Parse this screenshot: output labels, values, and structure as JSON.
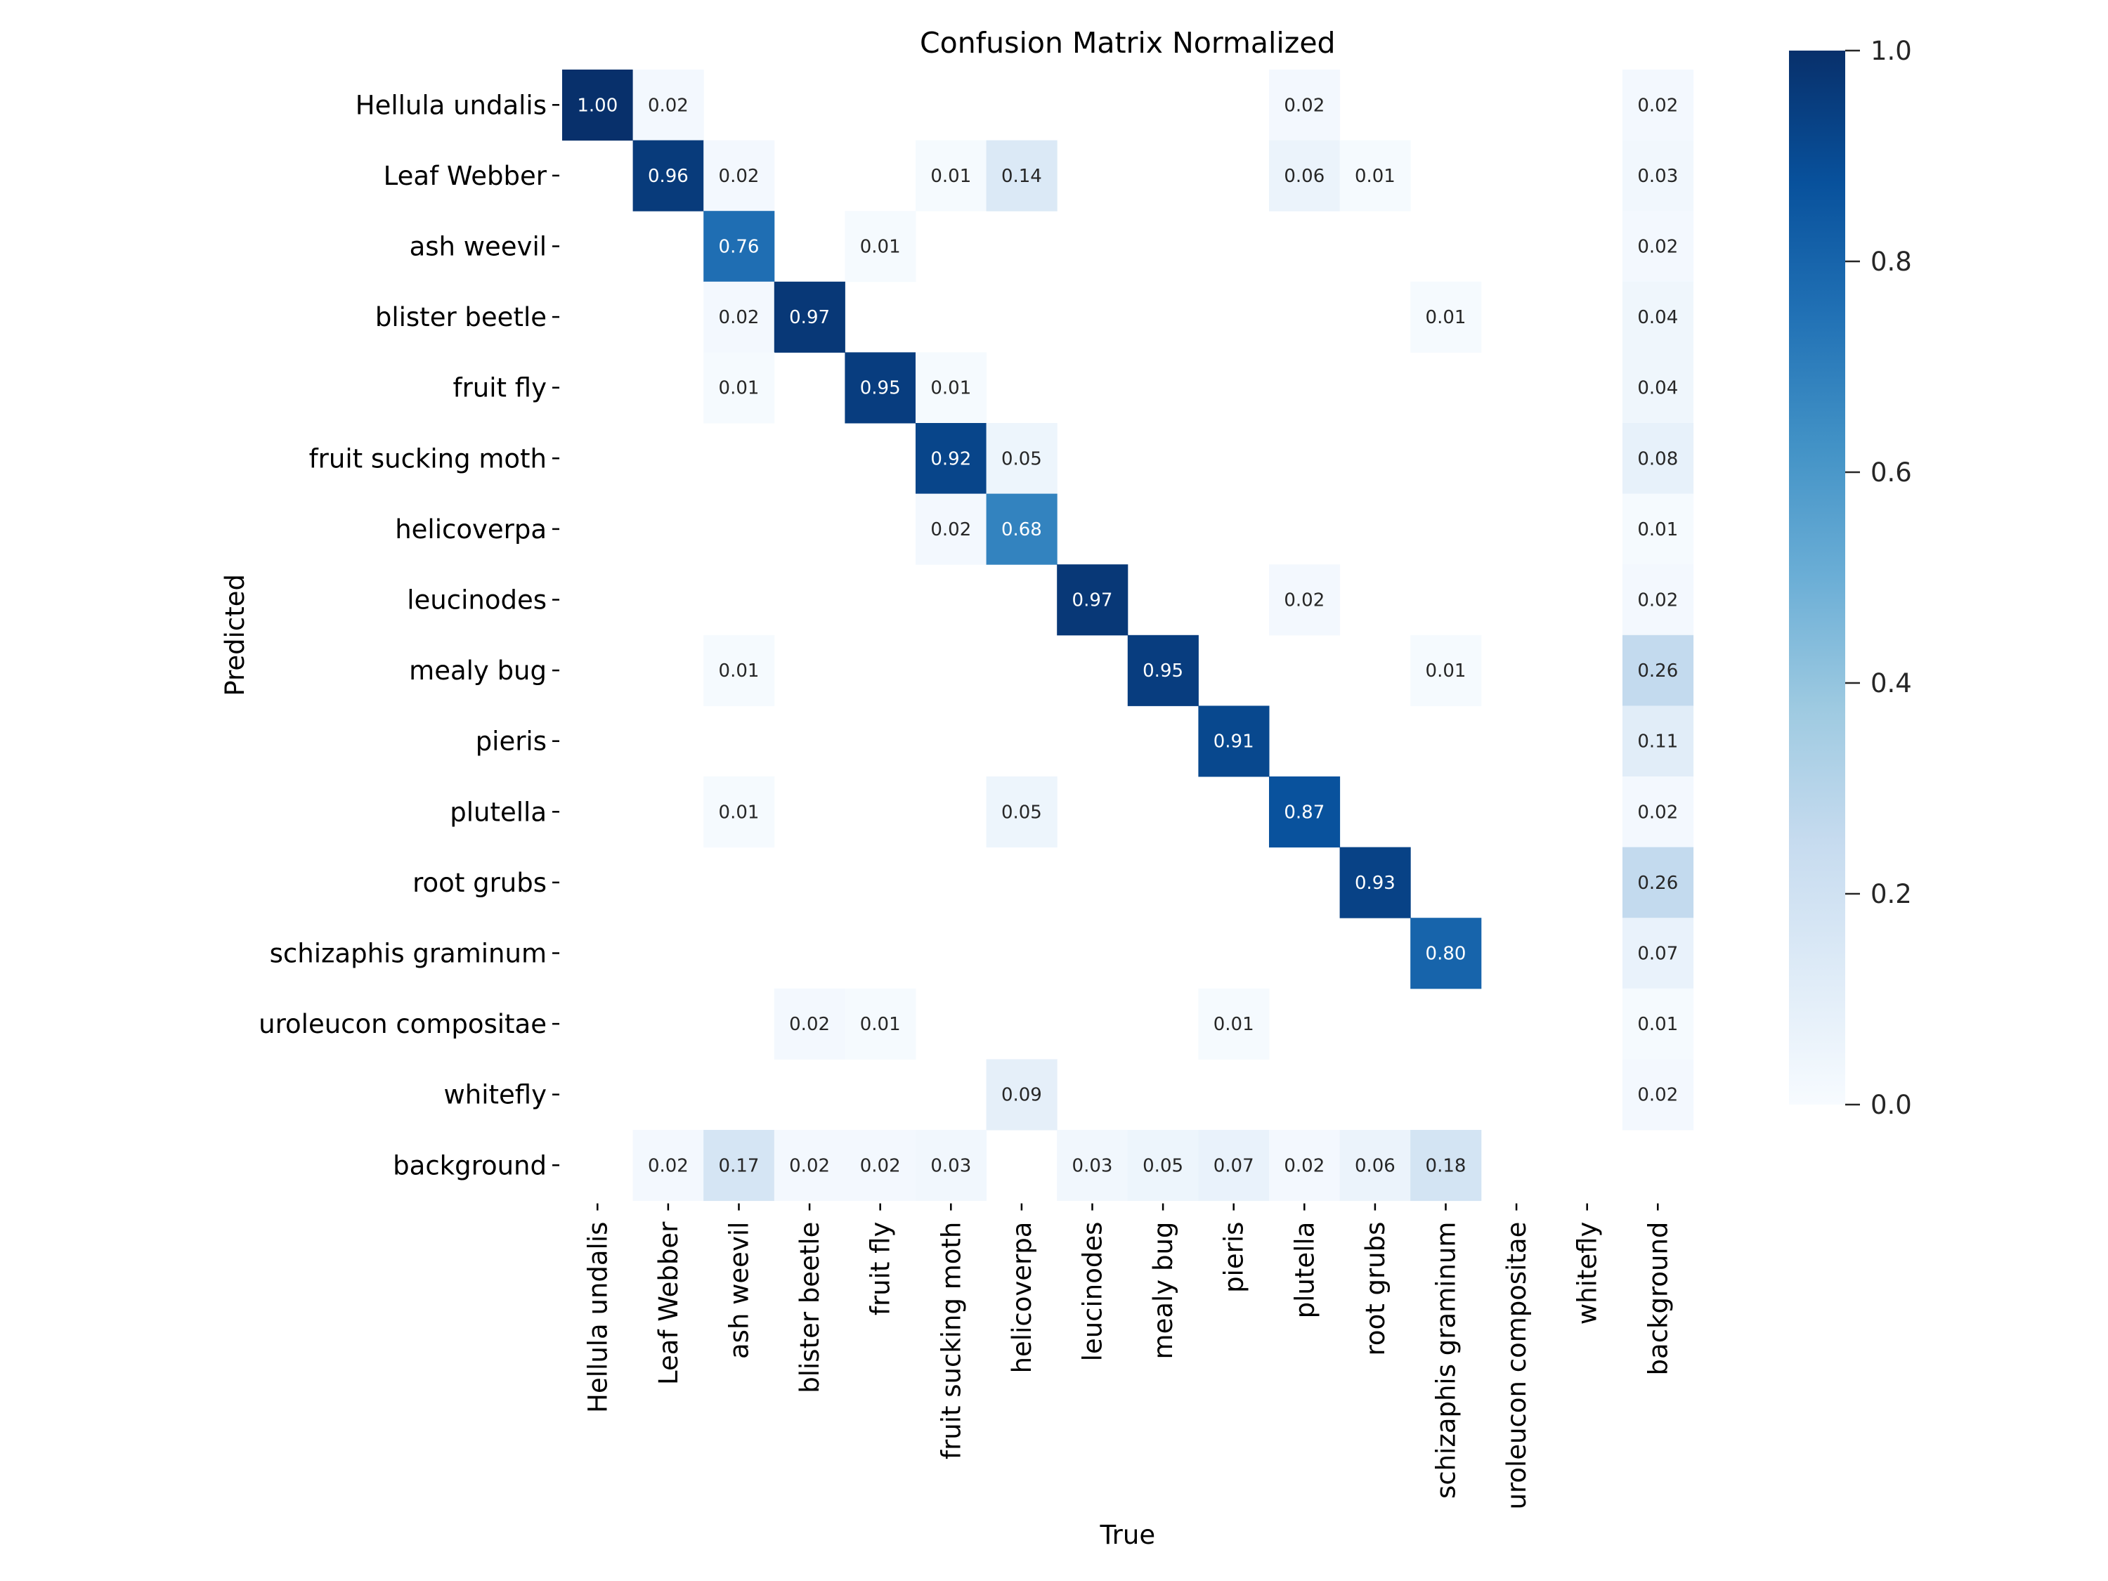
{
  "chart_data": {
    "type": "heatmap",
    "title": "Confusion Matrix Normalized",
    "xlabel": "True",
    "ylabel": "Predicted",
    "x_categories": [
      "Hellula undalis",
      "Leaf Webber",
      "ash weevil",
      "blister beetle",
      "fruit fly",
      "fruit sucking moth",
      "helicoverpa",
      "leucinodes",
      "mealy bug",
      "pieris",
      "plutella",
      "root grubs",
      "schizaphis graminum",
      "uroleucon compositae",
      "whitefly",
      "background"
    ],
    "y_categories": [
      "Hellula undalis",
      "Leaf Webber",
      "ash weevil",
      "blister beetle",
      "fruit fly",
      "fruit sucking moth",
      "helicoverpa",
      "leucinodes",
      "mealy bug",
      "pieris",
      "plutella",
      "root grubs",
      "schizaphis graminum",
      "uroleucon compositae",
      "whitefly",
      "background"
    ],
    "values": [
      [
        1.0,
        0.02,
        null,
        null,
        null,
        null,
        null,
        null,
        null,
        null,
        0.02,
        null,
        null,
        null,
        null,
        0.02
      ],
      [
        null,
        0.96,
        0.02,
        null,
        null,
        0.01,
        0.14,
        null,
        null,
        null,
        0.06,
        0.01,
        null,
        null,
        null,
        0.03
      ],
      [
        null,
        null,
        0.76,
        null,
        0.01,
        null,
        null,
        null,
        null,
        null,
        null,
        null,
        null,
        null,
        null,
        0.02
      ],
      [
        null,
        null,
        0.02,
        0.97,
        null,
        null,
        null,
        null,
        null,
        null,
        null,
        null,
        0.01,
        null,
        null,
        0.04
      ],
      [
        null,
        null,
        0.01,
        null,
        0.95,
        0.01,
        null,
        null,
        null,
        null,
        null,
        null,
        null,
        null,
        null,
        0.04
      ],
      [
        null,
        null,
        null,
        null,
        null,
        0.92,
        0.05,
        null,
        null,
        null,
        null,
        null,
        null,
        null,
        null,
        0.08
      ],
      [
        null,
        null,
        null,
        null,
        null,
        0.02,
        0.68,
        null,
        null,
        null,
        null,
        null,
        null,
        null,
        null,
        0.01
      ],
      [
        null,
        null,
        null,
        null,
        null,
        null,
        null,
        0.97,
        null,
        null,
        0.02,
        null,
        null,
        null,
        null,
        0.02
      ],
      [
        null,
        null,
        0.01,
        null,
        null,
        null,
        null,
        null,
        0.95,
        null,
        null,
        null,
        0.01,
        null,
        null,
        0.26
      ],
      [
        null,
        null,
        null,
        null,
        null,
        null,
        null,
        null,
        null,
        0.91,
        null,
        null,
        null,
        null,
        null,
        0.11
      ],
      [
        null,
        null,
        0.01,
        null,
        null,
        null,
        0.05,
        null,
        null,
        null,
        0.87,
        null,
        null,
        null,
        null,
        0.02
      ],
      [
        null,
        null,
        null,
        null,
        null,
        null,
        null,
        null,
        null,
        null,
        null,
        0.93,
        null,
        null,
        null,
        0.26
      ],
      [
        null,
        null,
        null,
        null,
        null,
        null,
        null,
        null,
        null,
        null,
        null,
        null,
        0.8,
        null,
        null,
        0.07
      ],
      [
        null,
        null,
        null,
        0.02,
        0.01,
        null,
        null,
        null,
        null,
        0.01,
        null,
        null,
        null,
        null,
        null,
        0.01
      ],
      [
        null,
        null,
        null,
        null,
        null,
        null,
        0.09,
        null,
        null,
        null,
        null,
        null,
        null,
        null,
        null,
        0.02
      ],
      [
        null,
        0.02,
        0.17,
        0.02,
        0.02,
        0.03,
        null,
        0.03,
        0.05,
        0.07,
        0.02,
        0.06,
        0.18,
        null,
        null,
        null
      ]
    ],
    "value_format": "0.00",
    "colormap": "Blues",
    "color_range": [
      0.0,
      1.0
    ],
    "colorbar": {
      "position": "right",
      "ticks": [
        0.0,
        0.2,
        0.4,
        0.6,
        0.8,
        1.0
      ],
      "tick_labels": [
        "0.0",
        "0.2",
        "0.4",
        "0.6",
        "0.8",
        "1.0"
      ]
    },
    "grid": false,
    "colors": {
      "text_dark": "#262626",
      "text_light": "#ffffff",
      "blues_stops": [
        "#f7fbff",
        "#deebf7",
        "#c6dbef",
        "#9ecae1",
        "#6baed6",
        "#4292c6",
        "#2171b5",
        "#08519c",
        "#08306b"
      ]
    }
  }
}
